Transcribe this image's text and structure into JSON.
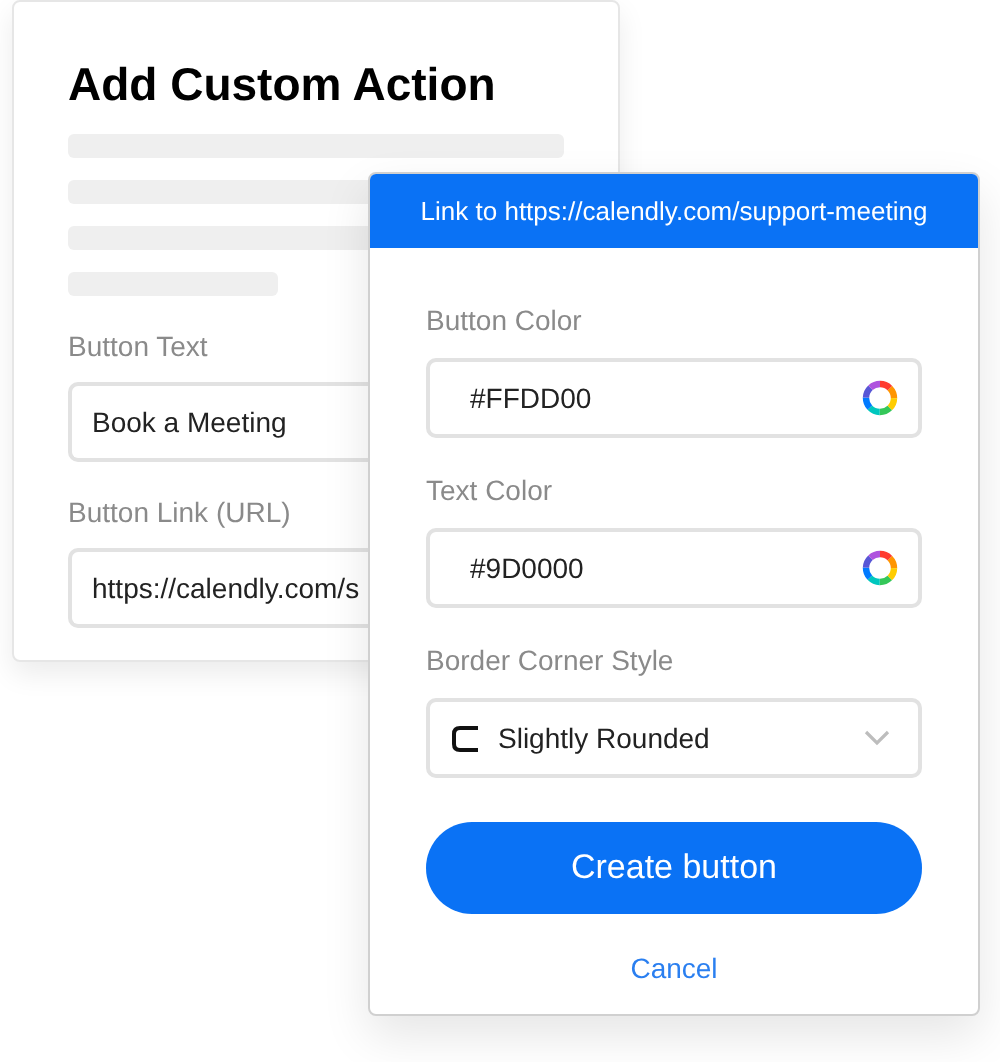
{
  "back_card": {
    "title": "Add Custom Action",
    "fields": [
      {
        "label": "Button Text",
        "value": "Book a Meeting"
      },
      {
        "label": "Button Link (URL)",
        "value": "https://calendly.com/s"
      }
    ]
  },
  "dialog": {
    "header": "Link to https://calendly.com/support-meeting",
    "fields": [
      {
        "kind": "color",
        "label": "Button Color",
        "value": "#FFDD00"
      },
      {
        "kind": "color",
        "label": "Text Color",
        "value": "#9D0000"
      },
      {
        "kind": "select",
        "label": "Border Corner Style",
        "value": "Slightly Rounded"
      }
    ],
    "primary_button": "Create button",
    "cancel_link": "Cancel"
  }
}
